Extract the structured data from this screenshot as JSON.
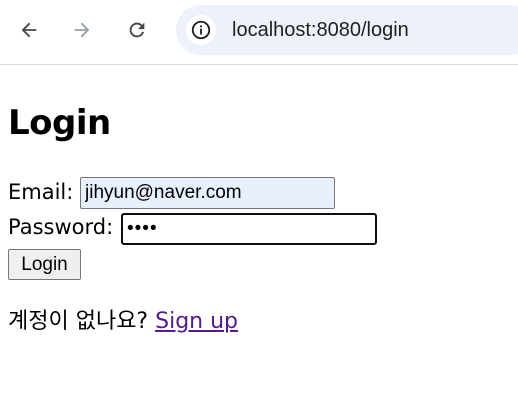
{
  "browser": {
    "back_icon": "arrow-left-icon",
    "forward_icon": "arrow-right-icon",
    "reload_icon": "reload-icon",
    "site_info_icon": "info-icon",
    "url": "localhost:8080/login",
    "forward_enabled": false
  },
  "page": {
    "title": "Login",
    "form": {
      "email_label": "Email:",
      "email_value": "jihyun@naver.com",
      "password_label": "Password:",
      "password_value": "••••",
      "submit_label": "Login"
    },
    "signup": {
      "prompt": "계정이 없나요?",
      "link_text": "Sign up"
    }
  },
  "colors": {
    "omnibox_bg": "#edf2fa",
    "autofill_bg": "#e8f0fe",
    "visited_link": "#551a8b",
    "disabled_icon": "#9aa0a6",
    "icon": "#474747"
  }
}
